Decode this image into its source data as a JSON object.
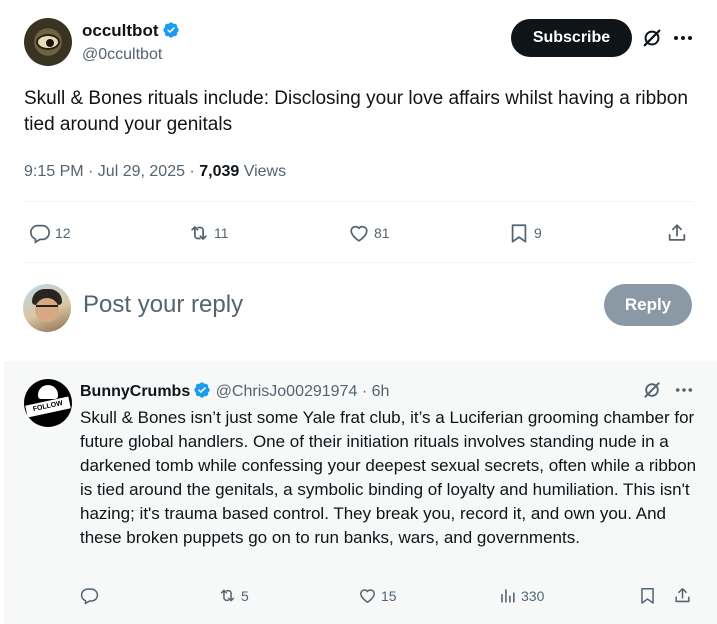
{
  "post": {
    "author_name": "occultbot",
    "author_handle": "@0ccultbot",
    "subscribe_label": "Subscribe",
    "text": "Skull & Bones rituals include: Disclosing your love affairs whilst having a ribbon tied around your genitals",
    "time": "9:15 PM · Jul 29, 2025 ·",
    "views_count": "7,039",
    "views_label": "Views",
    "actions": {
      "replies": "12",
      "reposts": "11",
      "likes": "81",
      "bookmarks": "9"
    }
  },
  "composer": {
    "placeholder": "Post your reply",
    "reply_label": "Reply"
  },
  "reply": {
    "author_name": "BunnyCrumbs",
    "author_handle": "@ChrisJo00291974",
    "time": "· 6h",
    "avatar_text": "FOLLOW",
    "text": "Skull & Bones isn’t just some Yale frat club, it’s a Luciferian grooming chamber for future global handlers. One of their initiation rituals involves standing nude in a darkened tomb while confessing your deepest sexual secrets, often while a ribbon is tied around the genitals, a symbolic binding of loyalty and humiliation. This isn't hazing; it's trauma based control. They break you, record it, and own you. And these broken puppets go on to run banks, wars, and governments.",
    "actions": {
      "reposts": "5",
      "likes": "15",
      "views": "330"
    }
  },
  "icons": [
    "verified-icon",
    "grok-icon",
    "more-icon",
    "reply-icon",
    "repost-icon",
    "like-icon",
    "bookmark-icon",
    "share-icon",
    "views-icon"
  ],
  "colors": {
    "text": "#0f1419",
    "muted": "#536471",
    "verified": "#1d9bf0",
    "subscribe_bg": "#0f1419",
    "reply_button_bg": "#8b98a5",
    "reply_card_bg": "#f7f9f9"
  }
}
